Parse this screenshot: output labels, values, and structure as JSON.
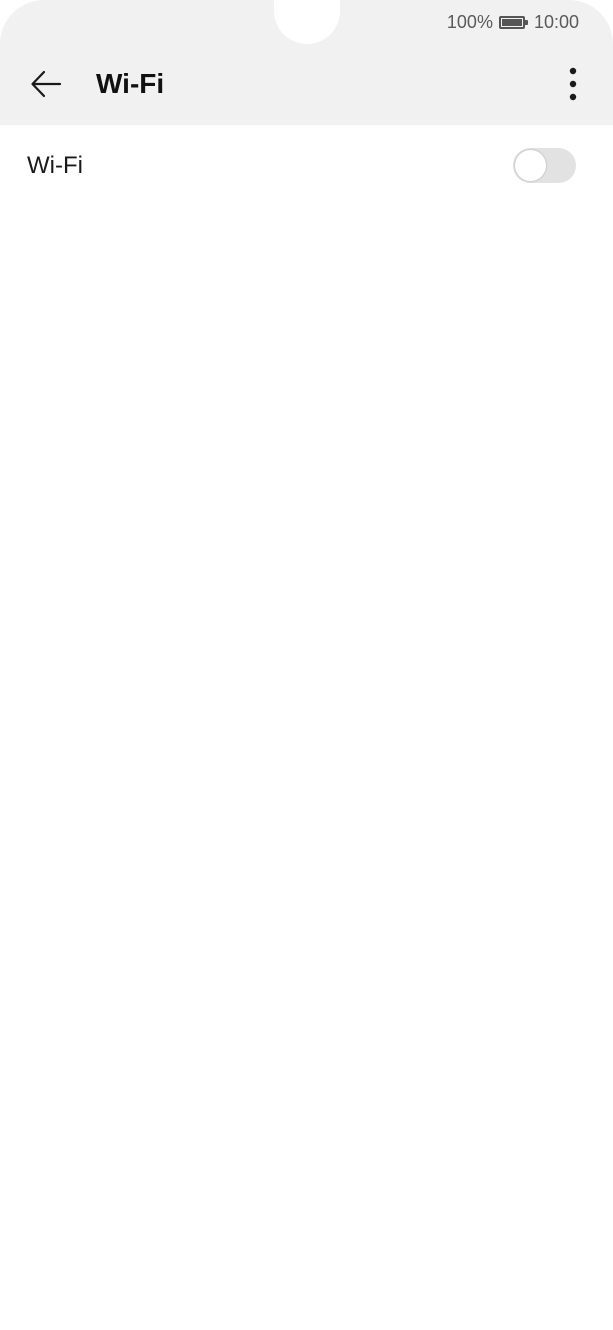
{
  "status_bar": {
    "battery_percent": "100%",
    "time": "10:00",
    "battery_icon": "battery-full-icon"
  },
  "toolbar": {
    "title": "Wi-Fi",
    "back_icon": "arrow-left-icon",
    "more_icon": "more-vertical-icon"
  },
  "settings": {
    "wifi_row": {
      "label": "Wi-Fi",
      "toggle_state": "off"
    }
  },
  "colors": {
    "header_background": "#f1f1f1",
    "page_background": "#ffffff",
    "toggle_off": "#e2e2e2",
    "text_primary": "#1a1a1a",
    "status_text": "#5a5a5a"
  }
}
